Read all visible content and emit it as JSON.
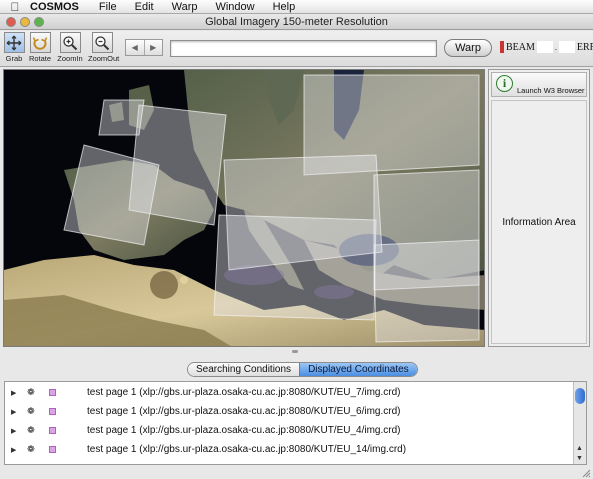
{
  "menubar": {
    "app_name": "COSMOS",
    "items": [
      "File",
      "Edit",
      "Warp",
      "Window",
      "Help"
    ]
  },
  "window": {
    "title": "Global Imagery 150-meter Resolution"
  },
  "toolbar": {
    "tools": [
      {
        "label": "Grab",
        "icon": "grab-icon"
      },
      {
        "label": "Rotate",
        "icon": "rotate-icon"
      },
      {
        "label": "ZoomIn",
        "icon": "zoom-in-icon"
      },
      {
        "label": "ZoomOut",
        "icon": "zoom-out-icon"
      }
    ],
    "url_value": "",
    "warp_label": "Warp",
    "beam_label": "BEAM",
    "err_label": "ERR"
  },
  "right_panel": {
    "launch_label": "Launch W3 Browser",
    "info_area_label": "Information Area"
  },
  "tabs": [
    {
      "label": "Searching Conditions",
      "selected": false
    },
    {
      "label": "Displayed Coordinates",
      "selected": true
    }
  ],
  "list": [
    {
      "text": "test page 1 (xlp://gbs.ur-plaza.osaka-cu.ac.jp:8080/KUT/EU_7/img.crd)"
    },
    {
      "text": "test page 1 (xlp://gbs.ur-plaza.osaka-cu.ac.jp:8080/KUT/EU_6/img.crd)"
    },
    {
      "text": "test page 1 (xlp://gbs.ur-plaza.osaka-cu.ac.jp:8080/KUT/EU_4/img.crd)"
    },
    {
      "text": "test page 1 (xlp://gbs.ur-plaza.osaka-cu.ac.jp:8080/KUT/EU_14/img.crd)"
    }
  ],
  "colors": {
    "selected_tab": "#4a8ee0",
    "layer_marker": "#d9a6e3",
    "ocean": "#05060c"
  }
}
